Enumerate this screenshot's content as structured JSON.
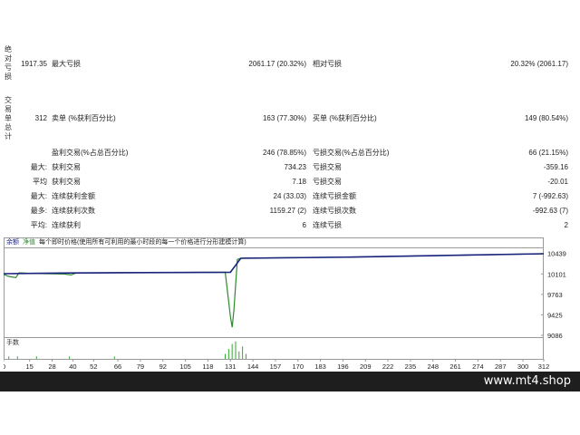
{
  "side_labels": {
    "drawdown": [
      "绝",
      "对",
      "亏",
      "损"
    ],
    "trades": [
      "交",
      "易",
      "单",
      "总",
      "计"
    ]
  },
  "rows": [
    {
      "id": "abs",
      "c1": "1917.35",
      "c2": "最大亏损",
      "c3": "2061.17 (20.32%)",
      "c4": "相对亏损",
      "c5": "20.32% (2061.17)"
    },
    {
      "id": "total",
      "c1": "312",
      "c2": "卖单 (%获利百分比)",
      "c3": "163 (77.30%)",
      "c4": "买单 (%获利百分比)",
      "c5": "149 (80.54%)"
    },
    {
      "id": "profit",
      "c1": "",
      "c2": "盈利交易(%占总百分比)",
      "c3": "246 (78.85%)",
      "c4": "亏损交易(%占总百分比)",
      "c5": "66 (21.15%)"
    },
    {
      "id": "largest",
      "c1": "最大:",
      "c2": "获利交易",
      "c3": "734.23",
      "c4": "亏损交易",
      "c5": "-359.16"
    },
    {
      "id": "average",
      "c1": "平均",
      "c2": "获利交易",
      "c3": "7.18",
      "c4": "亏损交易",
      "c5": "-20.01"
    },
    {
      "id": "maxcons",
      "c1": "最大:",
      "c2": "连续获利金额",
      "c3": "24 (33.03)",
      "c4": "连续亏损金额",
      "c5": "7 (-992.63)"
    },
    {
      "id": "maxamt",
      "c1": "最多:",
      "c2": "连续获利次数",
      "c3": "1159.27 (2)",
      "c4": "连续亏损次数",
      "c5": "-992.63 (7)"
    },
    {
      "id": "avgcons",
      "c1": "平均:",
      "c2": "连续获利",
      "c3": "6",
      "c4": "连续亏损",
      "c5": "2"
    }
  ],
  "chart_legend": {
    "balance": "余额",
    "equity": "净值",
    "note": "每个即时价格(使用所有可利用的最小时段的每一个价格进行分形建模计算)"
  },
  "volume_label": "手数",
  "colors": {
    "balance": "#1a237e",
    "equity": "#2e8b2e",
    "volume": "#2eaa2e",
    "grid": "#9a9a9a"
  },
  "chart_data": {
    "type": "line",
    "series": [
      {
        "name": "余额",
        "x": [
          0,
          15,
          40,
          131,
          137,
          200,
          312
        ],
        "y": [
          10105,
          10110,
          10118,
          10130,
          10360,
          10380,
          10435
        ]
      },
      {
        "name": "净值",
        "x": [
          0,
          3,
          7,
          9,
          15,
          35,
          39,
          42,
          128,
          130,
          131,
          132,
          133,
          135,
          137,
          140,
          200,
          312
        ],
        "y": [
          10095,
          10060,
          10040,
          10120,
          10110,
          10100,
          10085,
          10118,
          10130,
          9650,
          9400,
          9220,
          9500,
          10340,
          10360,
          10365,
          10380,
          10435
        ]
      }
    ],
    "yticks": [
      10439,
      10101,
      9763,
      9425,
      9086
    ],
    "xticks": [
      0,
      15,
      28,
      40,
      52,
      66,
      79,
      92,
      105,
      118,
      131,
      144,
      157,
      170,
      183,
      196,
      209,
      222,
      235,
      248,
      261,
      274,
      287,
      300,
      312
    ],
    "xlim": [
      0,
      312
    ],
    "ylim": [
      9086,
      10480
    ],
    "volume_bars": [
      {
        "x": 3,
        "v": 1
      },
      {
        "x": 8,
        "v": 1
      },
      {
        "x": 19,
        "v": 1
      },
      {
        "x": 38,
        "v": 1
      },
      {
        "x": 64,
        "v": 1
      },
      {
        "x": 128,
        "v": 2
      },
      {
        "x": 130,
        "v": 4
      },
      {
        "x": 132,
        "v": 6
      },
      {
        "x": 134,
        "v": 7
      },
      {
        "x": 136,
        "v": 3
      },
      {
        "x": 138,
        "v": 5
      },
      {
        "x": 140,
        "v": 2
      }
    ],
    "volume_max": 8
  }
}
